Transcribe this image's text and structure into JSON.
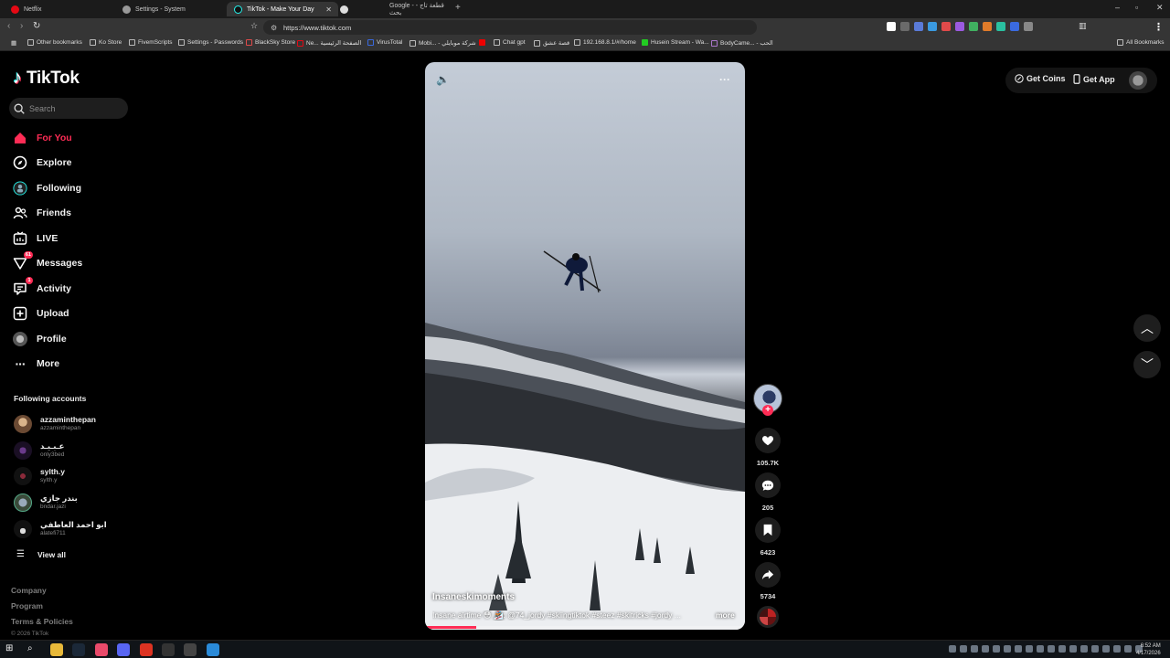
{
  "browser": {
    "tabs": [
      {
        "title": "Netflix",
        "active": false
      },
      {
        "title": "Settings - System",
        "active": false
      },
      {
        "title": "TikTok - Make Your Day",
        "active": true
      },
      {
        "title": "",
        "active": false
      },
      {
        "title": "Google - قطعة تاج - بحث",
        "active": false
      }
    ],
    "url": "https://www.tiktok.com",
    "bookmarks": [
      "Other bookmarks",
      "Ko Store",
      "FivemScripts",
      "Settings - Passwords",
      "BlackSky Store",
      "Ne... الصفحة الرئيسية",
      "VirusTotal",
      "Mobi... - شركة موبايلي",
      "Chat gpt",
      "قصة عشق",
      "192.168.8.1/#/home",
      "Husein Stream - Wa...",
      "BodyCame... - الحب"
    ],
    "all_bookmarks": "All Bookmarks"
  },
  "sidebar": {
    "logo_text": "TikTok",
    "search_placeholder": "Search",
    "nav": [
      {
        "label": "For You",
        "icon": "home-icon",
        "active": true
      },
      {
        "label": "Explore",
        "icon": "compass-icon"
      },
      {
        "label": "Following",
        "icon": "following-icon"
      },
      {
        "label": "Friends",
        "icon": "friends-icon"
      },
      {
        "label": "LIVE",
        "icon": "live-icon"
      },
      {
        "label": "Messages",
        "icon": "messages-icon",
        "badge": "61"
      },
      {
        "label": "Activity",
        "icon": "activity-icon",
        "badge": "1"
      },
      {
        "label": "Upload",
        "icon": "upload-icon"
      },
      {
        "label": "Profile",
        "icon": "profile-avatar"
      },
      {
        "label": "More",
        "icon": "more-icon"
      }
    ],
    "following_title": "Following accounts",
    "following_accounts": [
      {
        "name": "azzaminthepan",
        "username": "azzaminthepan",
        "color": "#8a6a4f"
      },
      {
        "name": "عـبـيـد",
        "username": "only3bed",
        "color": "#2a1a3a"
      },
      {
        "name": "sylth.y",
        "username": "sylth.y",
        "color": "#1a1a2a"
      },
      {
        "name": "بندر جازي",
        "username": "bndar.jazi",
        "color": "#4a5a4a"
      },
      {
        "name": "ابو احمد العاطفي",
        "username": "alatefi711",
        "color": "#222222"
      }
    ],
    "view_all": "View all",
    "footer_links": [
      "Company",
      "Program",
      "Terms & Policies"
    ],
    "copyright": "© 2026 TikTok"
  },
  "header": {
    "get_coins": "Get Coins",
    "get_app": "Get App"
  },
  "video": {
    "author": "Insaneskimoments",
    "caption": "Insane airtime 😳 🏂: @74_jordy #skiingtiktok #steez #skitricks #jordy ...",
    "more": "more",
    "progress": 0.16,
    "likes": "105.7K",
    "comments": "205",
    "saves": "6423",
    "shares": "5734"
  },
  "taskbar": {
    "time": "6:52 AM",
    "date": "4/17/2026"
  },
  "colors": {
    "accent": "#fe2c55",
    "background": "#000000"
  }
}
